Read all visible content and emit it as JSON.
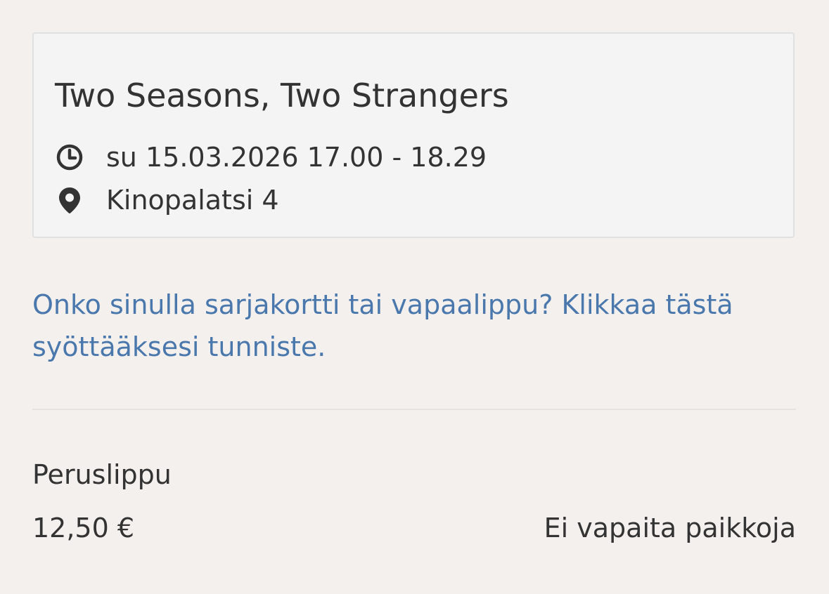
{
  "event": {
    "title": "Two Seasons, Two Strangers",
    "datetime": "su 15.03.2026 17.00 - 18.29",
    "venue": "Kinopalatsi 4",
    "time_icon": "clock-icon",
    "venue_icon": "location-pin-icon"
  },
  "voucher": {
    "link_text": "Onko sinulla sarjakortti tai vapaalippu? Klikkaa tästä syöttääksesi tunniste."
  },
  "ticket": {
    "name": "Peruslippu",
    "price": "12,50 €",
    "status": "Ei vapaita paikkoja"
  },
  "colors": {
    "background": "#f3f0ed",
    "card_background": "#f4f4f4",
    "card_border": "#e1e1e1",
    "text": "#333333",
    "link": "#4a78ad"
  }
}
